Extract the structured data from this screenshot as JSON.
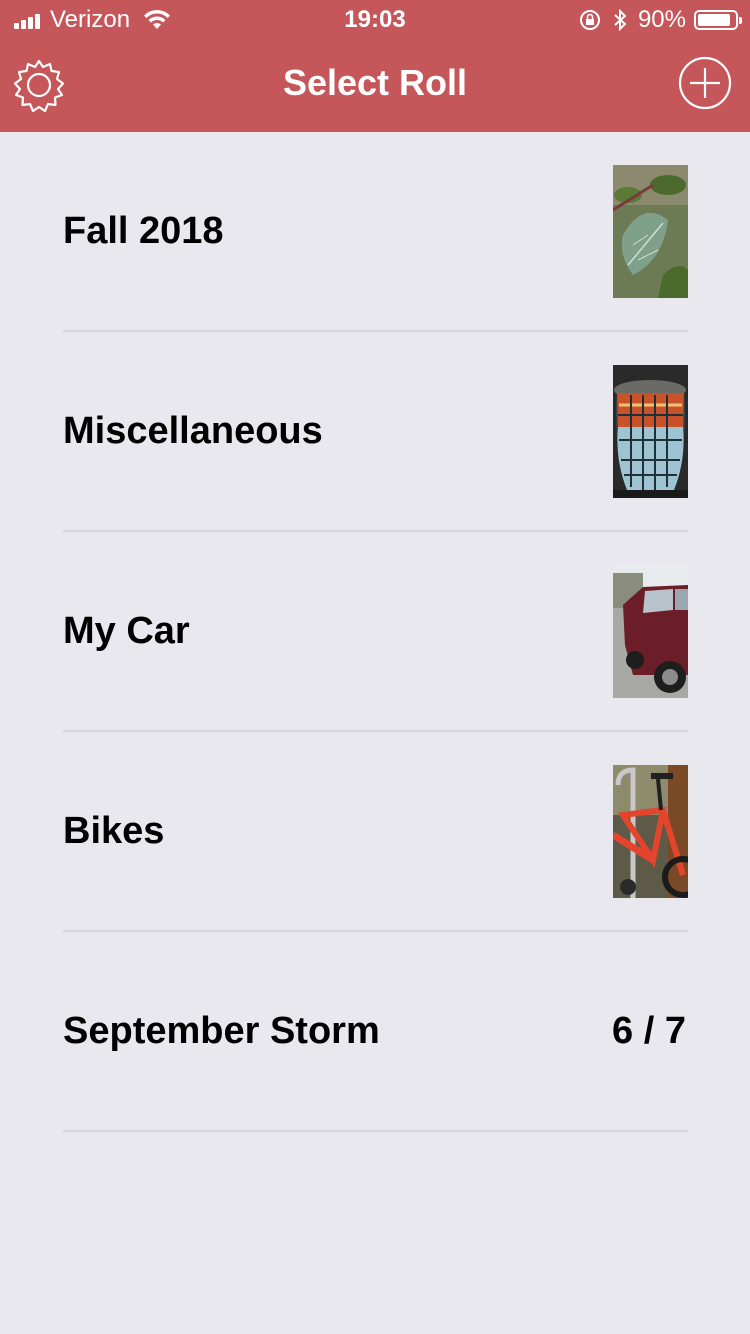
{
  "status": {
    "carrier": "Verizon",
    "time": "19:03",
    "battery_percent": "90%",
    "battery_level": 0.9
  },
  "header": {
    "title": "Select Roll",
    "left_icon": "gear-icon",
    "right_icon": "plus-circle-icon"
  },
  "colors": {
    "header_bg": "#c55659",
    "list_bg": "#e9e8ee"
  },
  "rolls": [
    {
      "label": "Fall 2018",
      "thumb": "leaves-photo"
    },
    {
      "label": "Miscellaneous",
      "thumb": "candle-holder-photo"
    },
    {
      "label": "My Car",
      "thumb": "red-truck-photo"
    },
    {
      "label": "Bikes",
      "thumb": "orange-bike-photo"
    },
    {
      "label": "September Storm",
      "count": "6 / 7"
    }
  ]
}
